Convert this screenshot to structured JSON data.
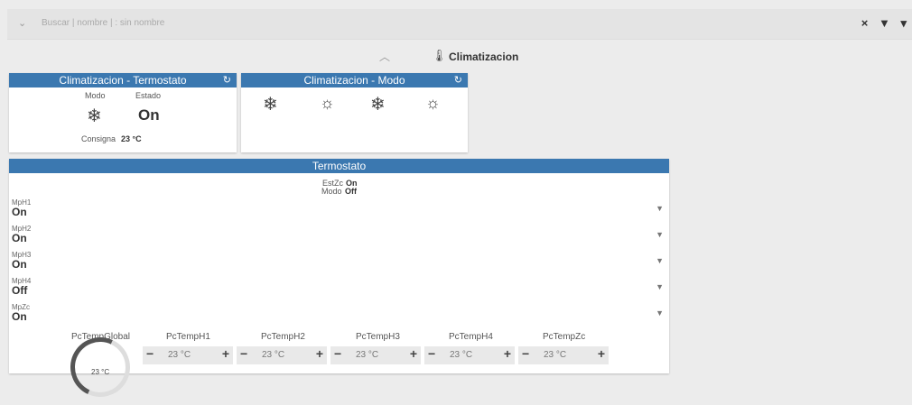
{
  "topbar": {
    "search_placeholder": "Buscar | nombre | : sin nombre",
    "tools": "× ▼ ▾"
  },
  "section": {
    "title": "Climatizacion"
  },
  "card_termostato": {
    "title": "Climatizacion - Termostato",
    "modo_label": "Modo",
    "estado_label": "Estado",
    "estado_value": "On",
    "consigna_label": "Consigna",
    "consigna_value": "23 °C"
  },
  "card_modo": {
    "title": "Climatizacion - Modo"
  },
  "termostato": {
    "title": "Termostato",
    "estzc_label": "EstZc",
    "estzc_value": "On",
    "modo_label": "Modo",
    "modo_value": "Off",
    "rows": [
      {
        "name": "MpH1",
        "value": "On"
      },
      {
        "name": "MpH2",
        "value": "On"
      },
      {
        "name": "MpH3",
        "value": "On"
      },
      {
        "name": "MpH4",
        "value": "Off"
      },
      {
        "name": "MpZc",
        "value": "On"
      }
    ],
    "controls": {
      "global": {
        "label": "PcTempGlobal",
        "value": "23 °C"
      },
      "steppers": [
        {
          "label": "PcTempH1",
          "value": "23 °C"
        },
        {
          "label": "PcTempH2",
          "value": "23 °C"
        },
        {
          "label": "PcTempH3",
          "value": "23 °C"
        },
        {
          "label": "PcTempH4",
          "value": "23 °C"
        },
        {
          "label": "PcTempZc",
          "value": "23 °C"
        }
      ]
    }
  }
}
